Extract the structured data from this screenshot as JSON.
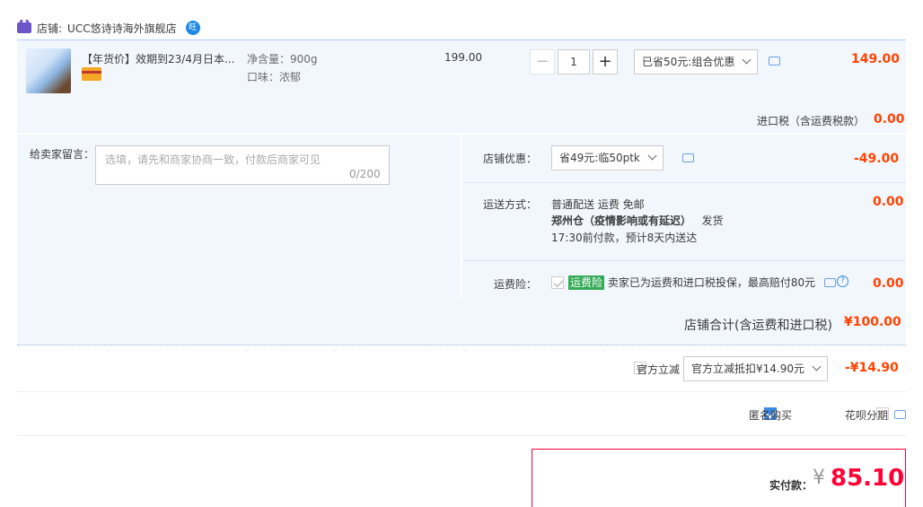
{
  "shop": {
    "label": "店铺:",
    "name": "UCC悠诗诗海外旗舰店"
  },
  "item": {
    "title": "【年货价】效期到23/4月日本...",
    "sku": [
      "净含量：900g",
      "口味：浓郁"
    ],
    "price": "199.00",
    "qty": "1",
    "discount_select": "已省50元:组合优惠",
    "subtotal": "149.00"
  },
  "import_tax": {
    "label": "进口税（含运费税款）",
    "value": "0.00"
  },
  "message": {
    "label": "给卖家留言：",
    "placeholder": "选填，请先和商家协商一致，付款后商家可见",
    "counter": "0/200"
  },
  "shop_discount": {
    "label": "店铺优惠：",
    "select": "省49元:临50ptk",
    "value": "-49.00"
  },
  "shipping": {
    "label": "运送方式：",
    "line1": "普通配送 运费 免邮",
    "line2_bold": "郑州仓（疫情影响或有延迟）",
    "line2_tail": "发货",
    "line3": "17:30前付款，预计8天内送达",
    "value": "0.00"
  },
  "shipping_insurance": {
    "label": "运费险：",
    "tag": "运费险",
    "text": "卖家已为运费和进口税投保，最高赔付80元",
    "value": "0.00"
  },
  "shop_total": {
    "label": "店铺合计(含运费和进口税)",
    "value": "¥100.00"
  },
  "official": {
    "label": "官方立减",
    "select": "官方立减抵扣¥14.90元",
    "value": "-¥14.90"
  },
  "options": {
    "anonymous": "匿名购买",
    "huabei": "花呗分期"
  },
  "payment": {
    "label": "实付款：",
    "currency": "¥",
    "amount": "85.10"
  },
  "colors": {
    "accent": "#f40",
    "border_blue": "#b2d1ff",
    "panel_bg": "#f2f6fd",
    "pay_border": "#ff0036"
  },
  "icons": [
    "shop-icon",
    "wangwang-icon",
    "card-icon",
    "chat-icon",
    "help-icon",
    "chevron-down-icon"
  ]
}
